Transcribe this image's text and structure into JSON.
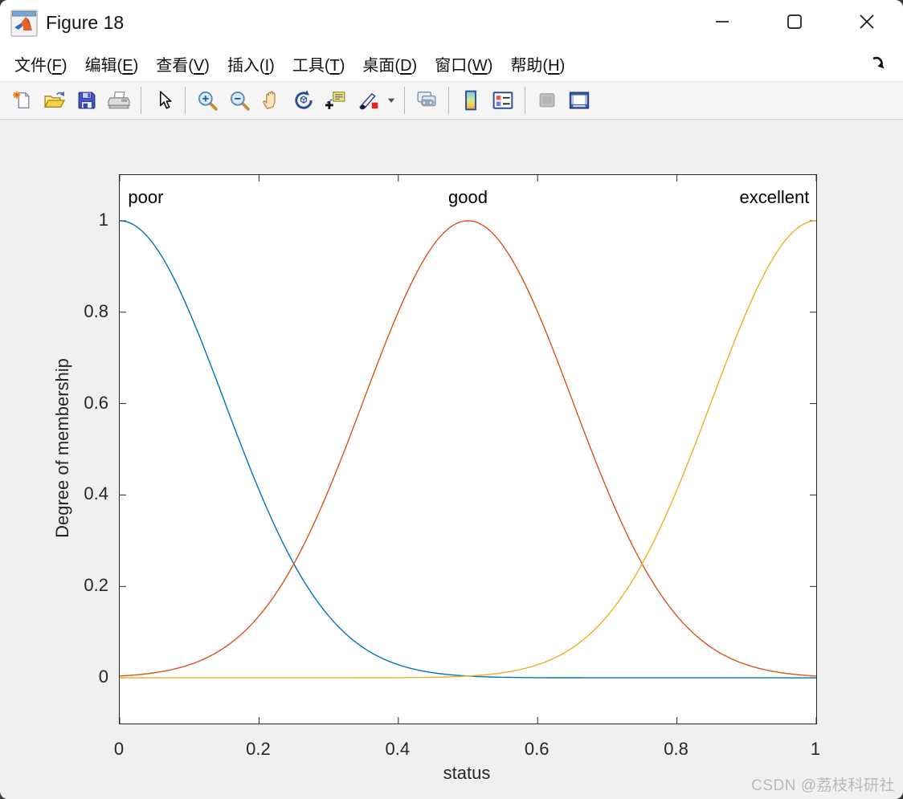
{
  "window": {
    "title": "Figure 18",
    "controls": {
      "minimize": "minimize",
      "maximize": "maximize",
      "close": "close"
    }
  },
  "menu": {
    "items": [
      {
        "label": "文件",
        "key": "F"
      },
      {
        "label": "编辑",
        "key": "E"
      },
      {
        "label": "查看",
        "key": "V"
      },
      {
        "label": "插入",
        "key": "I"
      },
      {
        "label": "工具",
        "key": "T"
      },
      {
        "label": "桌面",
        "key": "D"
      },
      {
        "label": "窗口",
        "key": "W"
      },
      {
        "label": "帮助",
        "key": "H"
      }
    ]
  },
  "toolbar": {
    "items": [
      "new-figure-icon",
      "open-file-icon",
      "save-icon",
      "print-icon",
      "|",
      "pointer-icon",
      "|",
      "zoom-in-icon",
      "zoom-out-icon",
      "pan-icon",
      "rotate-3d-icon",
      "data-cursor-icon",
      "brush-icon",
      "brush-dropdown-icon",
      "|",
      "link-plots-icon",
      "|",
      "insert-colorbar-icon",
      "insert-legend-icon",
      "|",
      "hide-plot-tools-icon",
      "show-plot-tools-icon"
    ]
  },
  "chart_data": {
    "type": "line",
    "title": "",
    "xlabel": "status",
    "ylabel": "Degree of membership",
    "xlim": [
      0,
      1
    ],
    "ylim": [
      -0.1,
      1.1
    ],
    "xticks": [
      0,
      0.2,
      0.4,
      0.6,
      0.8,
      1
    ],
    "xtick_labels": [
      "0",
      "0.2",
      "0.4",
      "0.6",
      "0.8",
      "1"
    ],
    "yticks": [
      0,
      0.2,
      0.4,
      0.6,
      0.8,
      1
    ],
    "ytick_labels": [
      "0",
      "0.2",
      "0.4",
      "0.6",
      "0.8",
      "1"
    ],
    "grid": false,
    "legend": "none",
    "series": [
      {
        "name": "poor",
        "mf": "gaussmf",
        "center": 0.0,
        "sigma": 0.15,
        "peak": 1.0,
        "color": "#0072BD"
      },
      {
        "name": "good",
        "mf": "gaussmf",
        "center": 0.5,
        "sigma": 0.15,
        "peak": 1.0,
        "color": "#D95319"
      },
      {
        "name": "excellent",
        "mf": "gaussmf",
        "center": 1.0,
        "sigma": 0.15,
        "peak": 1.0,
        "color": "#EDB120"
      }
    ],
    "annotations": [
      {
        "text": "poor",
        "x": 0.012,
        "y": 1.05,
        "align": "left"
      },
      {
        "text": "good",
        "x": 0.5,
        "y": 1.05,
        "align": "center"
      },
      {
        "text": "excellent",
        "x": 0.99,
        "y": 1.05,
        "align": "right"
      }
    ],
    "axes_color": "#262626",
    "background": "#ffffff"
  },
  "watermark": {
    "text": "CSDN @荔枝科研社",
    "color": "#b9b9b9"
  }
}
